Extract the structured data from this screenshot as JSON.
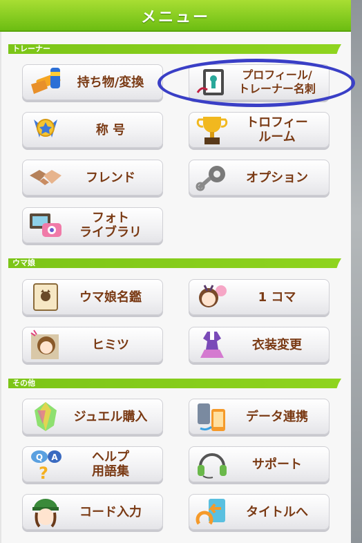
{
  "header": {
    "title": "メニュー"
  },
  "sections": [
    {
      "title": "トレーナー"
    },
    {
      "title": "ウマ娘"
    },
    {
      "title": "その他"
    }
  ],
  "buttons": {
    "items_exchange": "持ち物/変換",
    "profile": "プロフィール/\nトレーナー名刺",
    "title": "称 号",
    "trophy": "トロフィー\nルーム",
    "friend": "フレンド",
    "option": "オプション",
    "photo": "フォト\nライブラリ",
    "umamusume_directory": "ウマ娘名鑑",
    "one_koma": "1 コマ",
    "himitsu": "ヒミツ",
    "costume": "衣装変更",
    "jewel": "ジュエル購入",
    "data_link": "データ連携",
    "help": "ヘルプ\n用語集",
    "support": "サポート",
    "code": "コード入力",
    "to_title": "タイトルへ"
  },
  "colors": {
    "header_green": "#6cbd12",
    "label_brown": "#7a3a14",
    "highlight_circle": "#3a3fc6"
  }
}
